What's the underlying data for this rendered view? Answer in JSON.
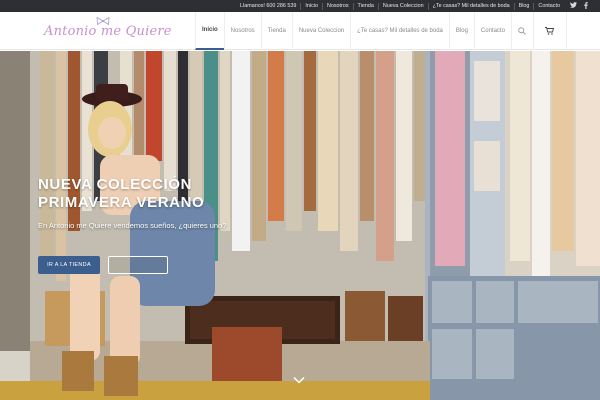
{
  "topbar": {
    "links": [
      "Llamanos! 600 286 539",
      "Inicio",
      "Nosotros",
      "Tienda",
      "Nueva Coleccion",
      "¿Te casas? Mil detalles de boda",
      "Blog",
      "Contacto"
    ],
    "social": [
      "twitter-icon",
      "facebook-icon"
    ]
  },
  "header": {
    "logo": "Antonio me Quiere",
    "nav": [
      "Inicio",
      "Nosotros",
      "Tienda",
      "Nueva Coleccion",
      "¿Te casas? Mil detalles de boda",
      "Blog",
      "Contacto"
    ],
    "active_nav": "Inicio",
    "icons": [
      "search-icon",
      "cart-icon"
    ]
  },
  "hero": {
    "title_line1": "NUEVA COLECCIÓN",
    "title_line2": "PRIMAVERA VERANO",
    "subtitle": "En Antonio me Quiere vendemos sueños, ¿quieres uno?",
    "primary_button": "IR A LA TIENDA",
    "secondary_button": "",
    "scroll_icon": "chevron-down-icon"
  },
  "colors": {
    "accent": "#3b5e8f",
    "topbar_bg": "#2e2f33",
    "logo": "#c88fd1"
  }
}
